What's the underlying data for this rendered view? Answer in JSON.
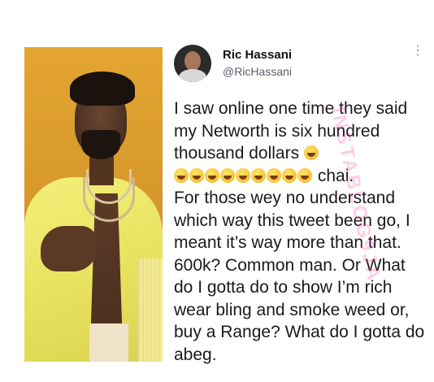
{
  "tweet": {
    "name": "Ric Hassani",
    "handle": "@RicHassani",
    "line1": "I saw online one time they said my Networth is six hundred thousand dollars",
    "line2_suffix": "chai.",
    "line3": "For those wey no understand which way this tweet been go, I meant it’s way more than that. 600k? Common man. Or What do I gotta do to show I’m rich wear bling and smoke weed or, buy a Range? What do I gotta do abeg.",
    "emoji_name": "rolling-on-floor-laughing-emoji",
    "emoji_count_line1": 1,
    "emoji_count_line2": 9
  },
  "watermark": "INSTABLOG9JA",
  "colors": {
    "photo_background": "#e4a531",
    "jacket": "#f5ef7a",
    "watermark": "#ff50aa"
  }
}
